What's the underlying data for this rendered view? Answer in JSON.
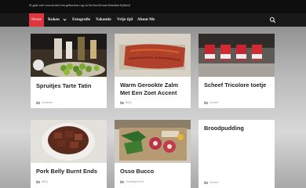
{
  "site": {
    "tagline": "Je gaat niet vooruit met een gebarsten rug en het hoofd naar beneden kijkend"
  },
  "nav": {
    "items": [
      {
        "label": "Home"
      },
      {
        "label": "Koken"
      },
      {
        "label": "Fotografie"
      },
      {
        "label": "Vakantie"
      },
      {
        "label": "Vrije tijd"
      },
      {
        "label": "About Me"
      }
    ],
    "search_icon": "search-icon"
  },
  "posts": [
    {
      "title": "Spruitjes Tarte Tatin",
      "category": "Groente"
    },
    {
      "title": "Warm Gerookte Zalm Met Een Zoet Accent",
      "category": "BBQ"
    },
    {
      "title": "Scheef Tricolore toetje",
      "category": "Desert"
    },
    {
      "title": "Pork Belly Burnt Ends",
      "category": "BBQ"
    },
    {
      "title": "Osso Bucco",
      "category": "Hoofdgerecht"
    },
    {
      "title": "Broodpudding",
      "category": "Desert"
    }
  ],
  "colors": {
    "accent": "#e0343f",
    "topbar": "#0e0e0e",
    "nav": "#191919"
  }
}
